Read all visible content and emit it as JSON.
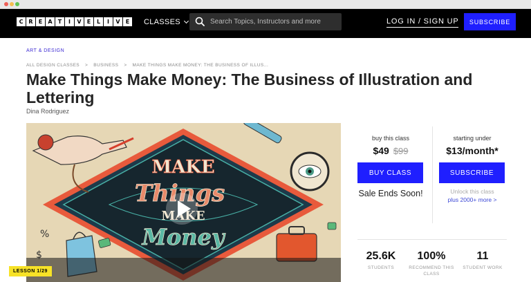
{
  "header": {
    "logo_letters": [
      "C",
      "R",
      "E",
      "A",
      "T",
      "I",
      "V",
      "E",
      "L",
      "I",
      "V",
      "E"
    ],
    "classes_label": "CLASSES",
    "search_placeholder": "Search Topics, Instructors and more",
    "login_label": "LOG IN / SIGN UP",
    "subscribe_label": "SUBSCRIBE"
  },
  "course": {
    "category": "ART & DESIGN",
    "breadcrumb": [
      "ALL DESIGN CLASSES",
      ">",
      "BUSINESS",
      ">",
      "MAKE THINGS MAKE MONEY: THE BUSINESS OF ILLUS..."
    ],
    "title": "Make Things Make Money: The Business of Illustration and Lettering",
    "author": "Dina Rodriguez"
  },
  "hero": {
    "lesson_badge": "LESSON 1/29",
    "art_words": [
      "MAKE",
      "Things",
      "MAKE",
      "Money"
    ]
  },
  "pricing": {
    "buy_label": "buy this class",
    "price": "$49",
    "old_price": "$99",
    "buy_button": "BUY CLASS",
    "sale_text": "Sale Ends Soon!",
    "sub_label": "starting under",
    "sub_price": "$13/month*",
    "sub_button": "SUBSCRIBE",
    "unlock_text": "Unlock this class",
    "more_text": "plus 2000+ more >"
  },
  "stats": [
    {
      "value": "25.6K",
      "label": "STUDENTS"
    },
    {
      "value": "100%",
      "label": "RECOMMEND THIS CLASS"
    },
    {
      "value": "11",
      "label": "STUDENT WORK"
    }
  ],
  "colors": {
    "accent_blue": "#1f1fff",
    "header_bg": "#000000",
    "badge_yellow": "#f7e227"
  }
}
